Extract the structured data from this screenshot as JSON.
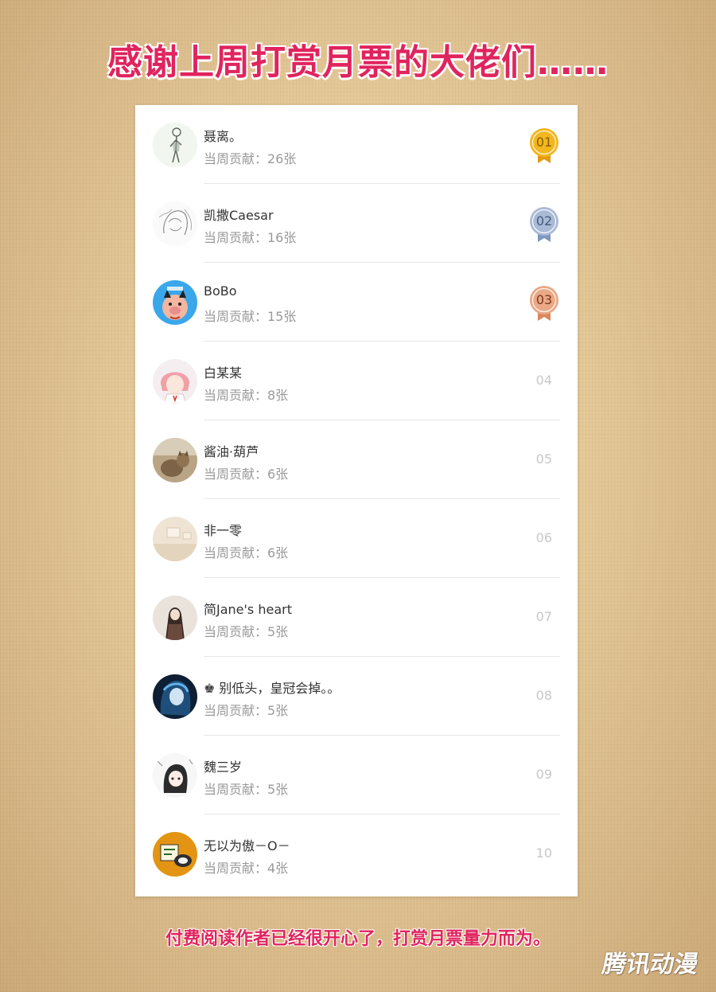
{
  "header": {
    "title": "感谢上周打赏月票的大佬们……"
  },
  "colors": {
    "accent": "#e0245e",
    "gold": "#f2b61e",
    "silver": "#9fb1cf",
    "bronze": "#e6a27e",
    "rank_gray": "#c8c8c8"
  },
  "list": {
    "items": [
      {
        "name": "聂离。",
        "contrib": "当周贡献：26张",
        "rank": "01",
        "medal": "gold",
        "avatar_icon": "sketch-figure-avatar"
      },
      {
        "name": "凯撒Caesar",
        "contrib": "当周贡献：16张",
        "rank": "02",
        "medal": "silver",
        "avatar_icon": "line-art-avatar"
      },
      {
        "name": "BoBo",
        "contrib": "当周贡献：15张",
        "rank": "03",
        "medal": "bronze",
        "avatar_icon": "cartoon-pig-avatar"
      },
      {
        "name": "白某某",
        "contrib": "当周贡献：8张",
        "rank": "04",
        "medal": "",
        "avatar_icon": "anime-girl-avatar"
      },
      {
        "name": "酱油·葫芦",
        "contrib": "当周贡献：6张",
        "rank": "05",
        "medal": "",
        "avatar_icon": "cat-photo-avatar"
      },
      {
        "name": "非一零",
        "contrib": "当周贡献：6张",
        "rank": "06",
        "medal": "",
        "avatar_icon": "room-photo-avatar"
      },
      {
        "name": "简Jane's heart",
        "contrib": "当周贡献：5张",
        "rank": "07",
        "medal": "",
        "avatar_icon": "dark-character-avatar"
      },
      {
        "name": "♚ 别低头，皇冠会掉。。",
        "contrib": "当周贡献：5张",
        "rank": "08",
        "medal": "",
        "avatar_icon": "blue-anime-avatar"
      },
      {
        "name": "魏三岁",
        "contrib": "当周贡献：5张",
        "rank": "09",
        "medal": "",
        "avatar_icon": "chibi-girl-avatar"
      },
      {
        "name": "无以为傲－O－",
        "contrib": "当周贡献：4张",
        "rank": "10",
        "medal": "",
        "avatar_icon": "orange-cat-avatar"
      }
    ]
  },
  "footer": {
    "text": "付费阅读作者已经很开心了，打赏月票量力而为。"
  },
  "watermark": {
    "text": "腾讯动漫"
  }
}
